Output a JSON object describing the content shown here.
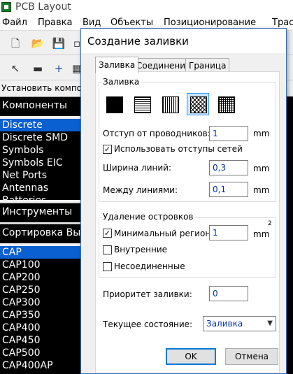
{
  "app": {
    "title": "PCB Layout",
    "menu": [
      "Файл",
      "Правка",
      "Вид",
      "Объекты",
      "Позиционирование",
      "Трас"
    ],
    "hint": "Установить компонент"
  },
  "left_panel": {
    "components_header": "Компоненты",
    "libraries": [
      "Discrete",
      "Discrete SMD",
      "Symbols",
      "Symbols EIC",
      "Net Ports",
      "Antennas",
      "Batteries"
    ],
    "selected_library": "Discrete",
    "tools_header": "Инструменты",
    "sort_header": "Сортировка Выкл",
    "parts": [
      "CAP",
      "CAP100",
      "CAP200",
      "CAP250",
      "CAP300",
      "CAP350",
      "CAP400",
      "CAP450",
      "CAP500",
      "CAP400AP"
    ],
    "selected_part": "CAP"
  },
  "dialog": {
    "title": "Создание заливки",
    "tabs": [
      "Заливка",
      "Соединения",
      "Граница"
    ],
    "active_tab": "Заливка",
    "fill_group_label": "Заливка",
    "patterns": [
      "solid",
      "horizontal",
      "vertical",
      "crosshatch-diagonal",
      "grid"
    ],
    "selected_pattern": "crosshatch-diagonal",
    "offset_label": "Отступ от проводников:",
    "offset_value": "1",
    "offset_unit": "mm",
    "use_net_offsets_label": "Использовать отступы сетей",
    "use_net_offsets_checked": true,
    "line_width_label": "Ширина линий:",
    "line_width_value": "0,3",
    "line_width_unit": "mm",
    "line_spacing_label": "Между линиями:",
    "line_spacing_value": "0,1",
    "line_spacing_unit": "mm",
    "islands_group_label": "Удаление островков",
    "min_region_label": "Минимальный регион:",
    "min_region_checked": true,
    "min_region_value": "1",
    "min_region_unit": "mm",
    "min_region_unit_sup": "2",
    "inner_label": "Внутренние",
    "inner_checked": false,
    "unconnected_label": "Несоединенные",
    "unconnected_checked": false,
    "priority_label": "Приоритет заливки:",
    "priority_value": "0",
    "state_label": "Текущее состояние:",
    "state_value": "Заливка",
    "ok_label": "OK",
    "cancel_label": "Отмена"
  }
}
